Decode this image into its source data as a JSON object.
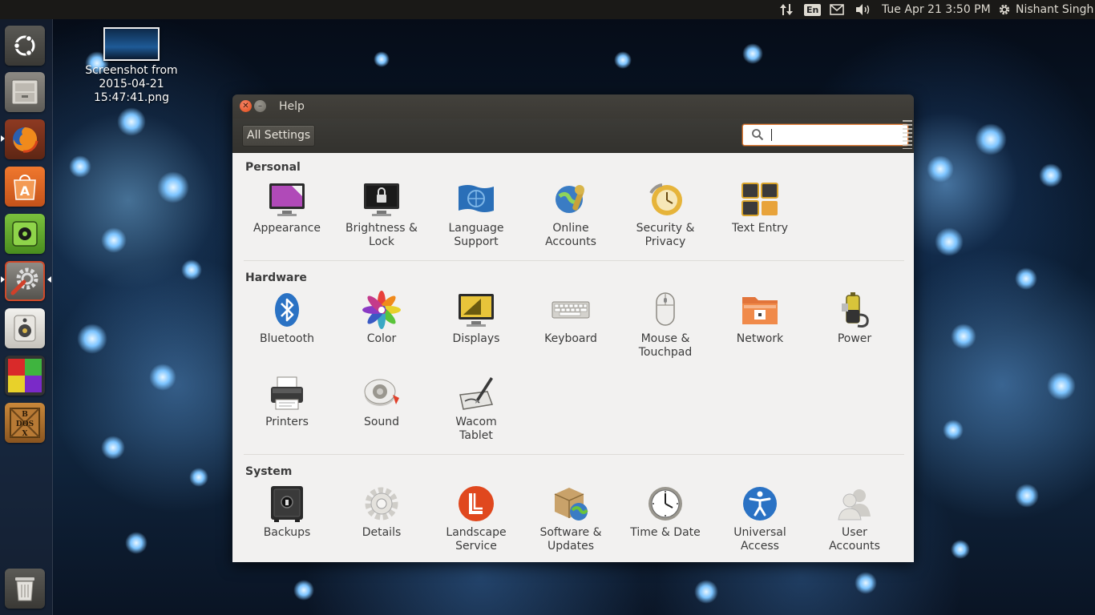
{
  "top_panel": {
    "lang": "En",
    "datetime": "Tue Apr 21  3:50 PM",
    "user": "Nishant Singh"
  },
  "desktop": {
    "file_label_1": "Screenshot from",
    "file_label_2": "2015-04-21",
    "file_label_3": "15:47:41.png"
  },
  "window": {
    "title": "Help",
    "all_settings": "All Settings",
    "search_placeholder": "",
    "search_value": ""
  },
  "sections": {
    "personal": "Personal",
    "hardware": "Hardware",
    "system": "System"
  },
  "items": {
    "appearance": [
      "Appearance"
    ],
    "brightness": [
      "Brightness &",
      "Lock"
    ],
    "language": [
      "Language",
      "Support"
    ],
    "online": [
      "Online",
      "Accounts"
    ],
    "security": [
      "Security &",
      "Privacy"
    ],
    "textentry": [
      "Text Entry"
    ],
    "bluetooth": [
      "Bluetooth"
    ],
    "color": [
      "Color"
    ],
    "displays": [
      "Displays"
    ],
    "keyboard": [
      "Keyboard"
    ],
    "mouse": [
      "Mouse &",
      "Touchpad"
    ],
    "network": [
      "Network"
    ],
    "power": [
      "Power"
    ],
    "printers": [
      "Printers"
    ],
    "sound": [
      "Sound"
    ],
    "wacom": [
      "Wacom",
      "Tablet"
    ],
    "backups": [
      "Backups"
    ],
    "details": [
      "Details"
    ],
    "landscape": [
      "Landscape",
      "Service"
    ],
    "software": [
      "Software &",
      "Updates"
    ],
    "timedate": [
      "Time & Date"
    ],
    "universal": [
      "Universal",
      "Access"
    ],
    "users": [
      "User",
      "Accounts"
    ]
  },
  "launcher_icons": [
    "ubuntu-dash-icon",
    "files-icon",
    "firefox-icon",
    "software-center-icon",
    "green-app-icon",
    "system-settings-icon",
    "speaker-icon",
    "blocks-game-icon",
    "dosbox-icon",
    "trash-icon"
  ],
  "colors": {
    "accent": "#e9823a",
    "panel": "#1a1917",
    "window_bg": "#f2f1f0",
    "titlebar": "#3c3b37"
  }
}
